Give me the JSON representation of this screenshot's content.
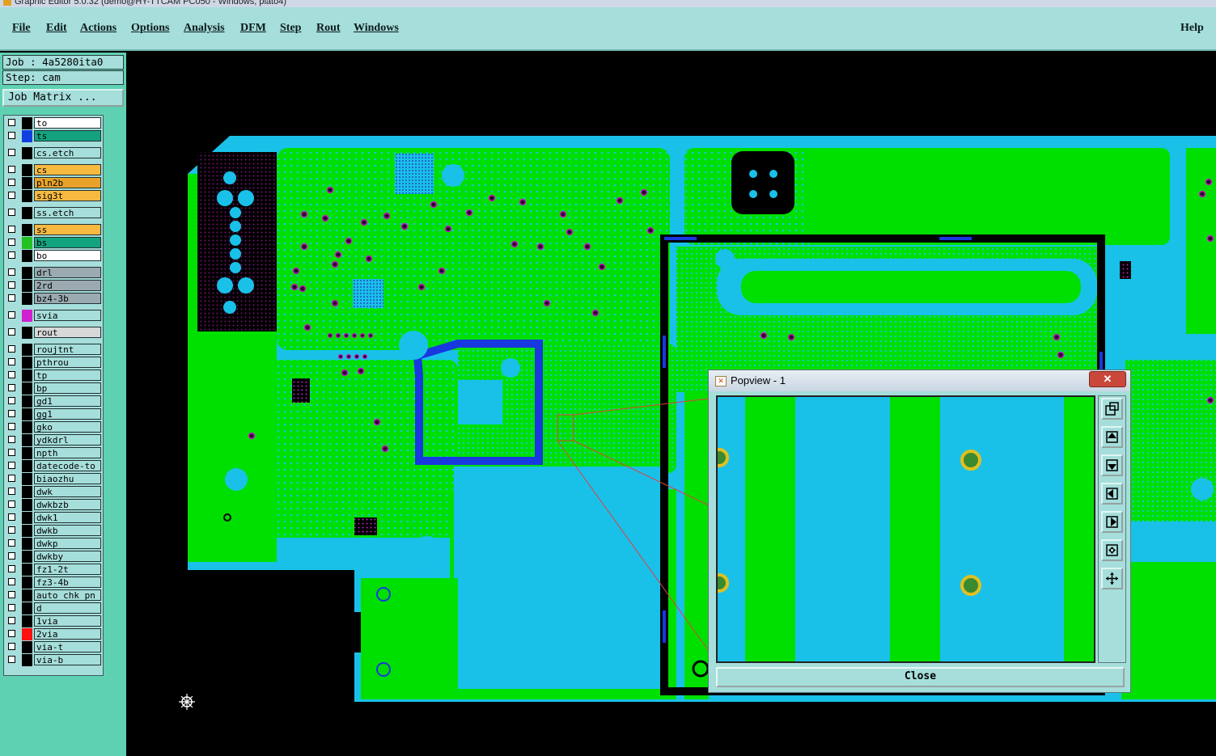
{
  "window": {
    "title": "Graphic Editor 5.0.32 (demo@HY-TTCAM PC050 - Windows, plato4)"
  },
  "menu": {
    "items": [
      "File",
      "Edit",
      "Actions",
      "Options",
      "Analysis",
      "DFM",
      "Step",
      "Rout",
      "Windows"
    ],
    "help": "Help"
  },
  "job": {
    "job_label": "Job : 4a5280ita0",
    "step_label": "Step: cam",
    "matrix_button": "Job Matrix ..."
  },
  "layers": [
    {
      "name": "to",
      "color": "#ffffff",
      "swatch": "#000000"
    },
    {
      "name": "ts",
      "color": "#14a37f",
      "swatch": "#1040e0"
    },
    {
      "name": "cs.etch",
      "color": "#a6dedb",
      "swatch": "#000000"
    },
    {
      "name": "cs",
      "color": "#f7b940",
      "swatch": "#000000"
    },
    {
      "name": "pln2b",
      "color": "#e8a22a",
      "swatch": "#000000"
    },
    {
      "name": "sig3t",
      "color": "#f7b940",
      "swatch": "#000000"
    },
    {
      "name": "ss.etch",
      "color": "#a6dedb",
      "swatch": "#000000"
    },
    {
      "name": "ss",
      "color": "#f7b940",
      "swatch": "#000000"
    },
    {
      "name": "bs",
      "color": "#14a37f",
      "swatch": "#22c020"
    },
    {
      "name": "bo",
      "color": "#ffffff",
      "swatch": "#000000"
    },
    {
      "name": "drl",
      "color": "#9aaab0",
      "swatch": "#000000"
    },
    {
      "name": "2rd",
      "color": "#9aaab0",
      "swatch": "#000000"
    },
    {
      "name": "bz4-3b",
      "color": "#9aaab0",
      "swatch": "#000000"
    },
    {
      "name": "svia",
      "color": "#a6dedb",
      "swatch": "#d020d0"
    },
    {
      "name": "rout",
      "color": "#d8d8d8",
      "swatch": "#000000"
    },
    {
      "name": "roujtnt",
      "color": "#a6dedb",
      "swatch": "#000000"
    },
    {
      "name": "pthrou",
      "color": "#a6dedb",
      "swatch": "#000000"
    },
    {
      "name": "tp",
      "color": "#a6dedb",
      "swatch": "#000000"
    },
    {
      "name": "bp",
      "color": "#a6dedb",
      "swatch": "#000000"
    },
    {
      "name": "gd1",
      "color": "#a6dedb",
      "swatch": "#000000"
    },
    {
      "name": "gg1",
      "color": "#a6dedb",
      "swatch": "#000000"
    },
    {
      "name": "gko",
      "color": "#a6dedb",
      "swatch": "#000000"
    },
    {
      "name": "ydkdrl",
      "color": "#a6dedb",
      "swatch": "#000000"
    },
    {
      "name": "npth",
      "color": "#a6dedb",
      "swatch": "#000000"
    },
    {
      "name": "datecode-to",
      "color": "#a6dedb",
      "swatch": "#000000"
    },
    {
      "name": "biaozhu",
      "color": "#a6dedb",
      "swatch": "#000000"
    },
    {
      "name": "dwk",
      "color": "#a6dedb",
      "swatch": "#000000"
    },
    {
      "name": "dwkbzb",
      "color": "#a6dedb",
      "swatch": "#000000"
    },
    {
      "name": "dwk1",
      "color": "#a6dedb",
      "swatch": "#000000"
    },
    {
      "name": "dwkb",
      "color": "#a6dedb",
      "swatch": "#000000"
    },
    {
      "name": "dwkp",
      "color": "#a6dedb",
      "swatch": "#000000"
    },
    {
      "name": "dwkby",
      "color": "#a6dedb",
      "swatch": "#000000"
    },
    {
      "name": "fz1-2t",
      "color": "#a6dedb",
      "swatch": "#000000"
    },
    {
      "name": "fz3-4b",
      "color": "#a6dedb",
      "swatch": "#000000"
    },
    {
      "name": "auto_chk_pn",
      "color": "#a6dedb",
      "swatch": "#000000"
    },
    {
      "name": "d",
      "color": "#a6dedb",
      "swatch": "#000000"
    },
    {
      "name": "1via",
      "color": "#a6dedb",
      "swatch": "#000000"
    },
    {
      "name": "2via",
      "color": "#a6dedb",
      "swatch": "#ff1010"
    },
    {
      "name": "via-t",
      "color": "#a6dedb",
      "swatch": "#000000"
    },
    {
      "name": "via-b",
      "color": "#a6dedb",
      "swatch": "#000000"
    }
  ],
  "popup": {
    "title": "Popview - 1",
    "close_label": "Close",
    "close_x": "✕"
  },
  "colors": {
    "copper": "#00e000",
    "substrate": "#19c1e9",
    "panel": "#a6dedb",
    "left_bg": "#5fd1b3",
    "outline_blue": "#1838e0"
  }
}
